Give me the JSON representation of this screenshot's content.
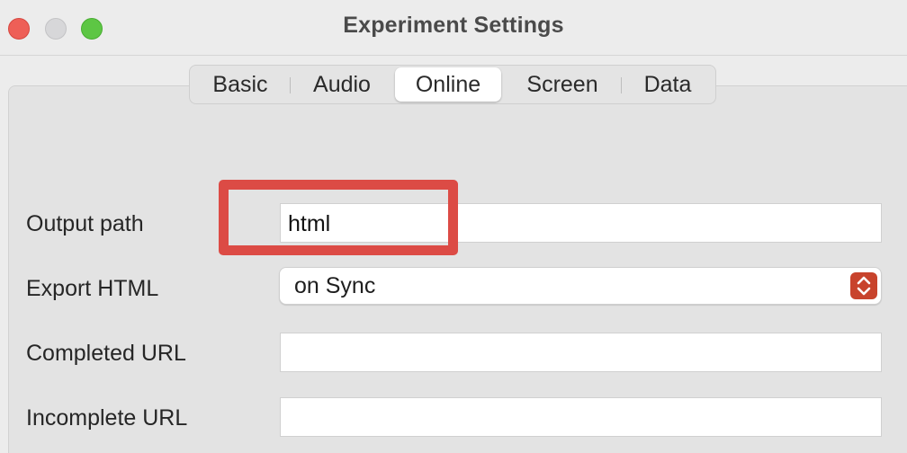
{
  "window": {
    "title": "Experiment Settings"
  },
  "tabs": [
    {
      "label": "Basic",
      "active": false
    },
    {
      "label": "Audio",
      "active": false
    },
    {
      "label": "Online",
      "active": true
    },
    {
      "label": "Screen",
      "active": false
    },
    {
      "label": "Data",
      "active": false
    }
  ],
  "form": {
    "output_path": {
      "label": "Output path",
      "value": "html"
    },
    "export_html": {
      "label": "Export HTML",
      "value": "on Sync"
    },
    "completed_url": {
      "label": "Completed URL",
      "value": ""
    },
    "incomplete_url": {
      "label": "Incomplete URL",
      "value": ""
    }
  },
  "colors": {
    "highlight": "#dc4b45",
    "stepper": "#c8432c",
    "close": "#ee5f57",
    "minimize": "#d7d7d9",
    "maximize": "#5dc644"
  },
  "icons": {
    "stepper": "chevron-up-down-icon"
  }
}
